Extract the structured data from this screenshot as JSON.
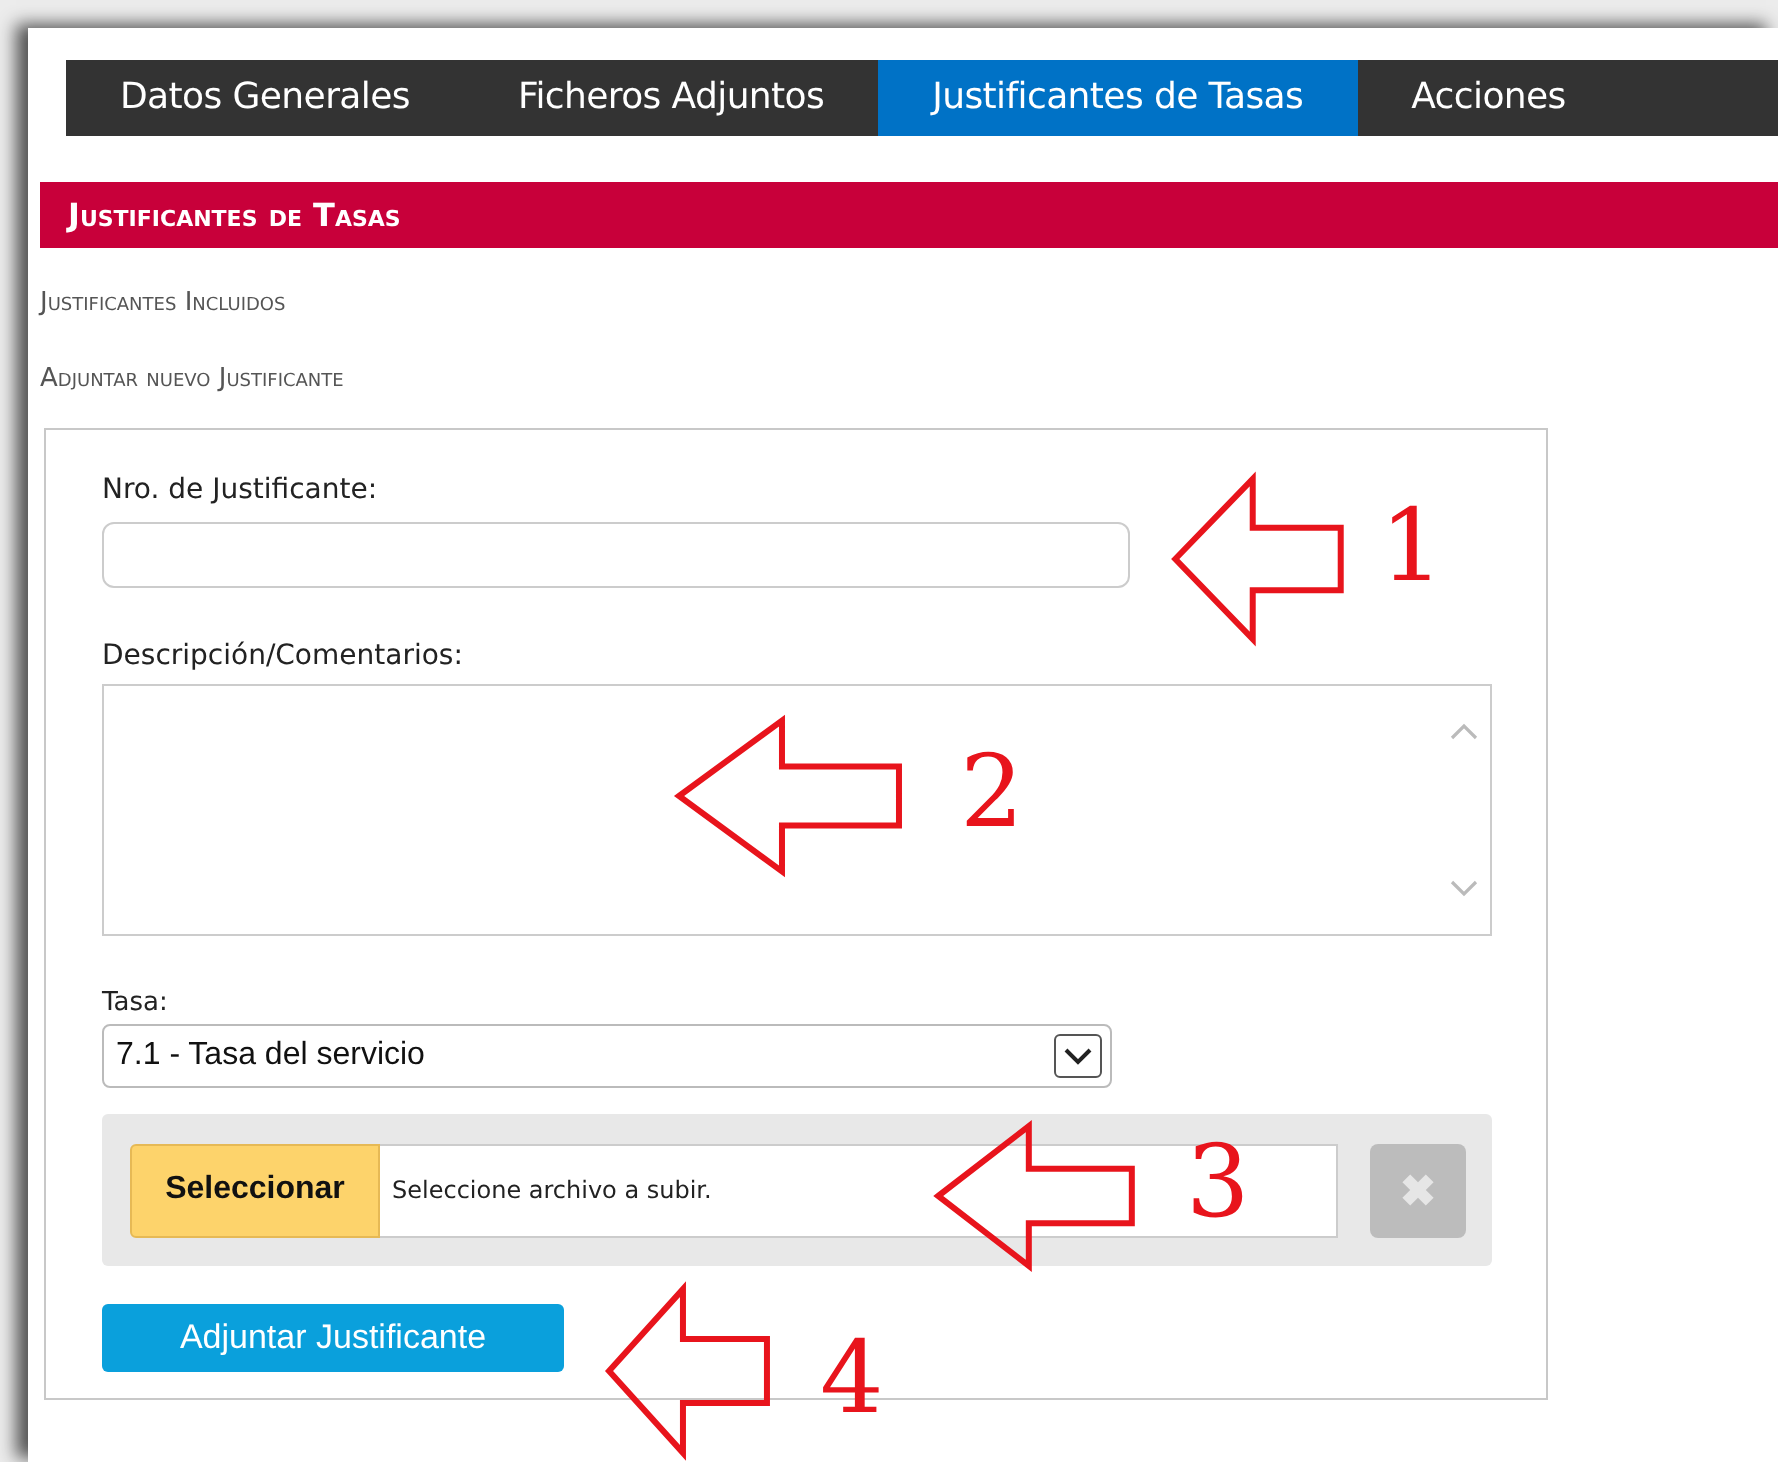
{
  "tabs": [
    {
      "label": "Datos Generales",
      "selected": false
    },
    {
      "label": "Ficheros Adjuntos",
      "selected": false
    },
    {
      "label": "Justificantes de Tasas",
      "selected": true
    },
    {
      "label": "Acciones",
      "selected": false
    }
  ],
  "section_title": "Justificantes de Tasas",
  "links": [
    "Justificantes Incluidos",
    "Adjuntar nuevo Justificante"
  ],
  "form": {
    "number_label": "Nro. de Justificante:",
    "description_label": "Descripción/Comentarios:",
    "tasa_label": "Tasa:",
    "tasa_value": "7.1 - Tasa del servicio",
    "select_button": "Seleccionar",
    "file_placeholder": "Seleccione archivo a subir.",
    "submit_button": "Adjuntar Justificante"
  },
  "annotations": [
    {
      "number": "1"
    },
    {
      "number": "2"
    },
    {
      "number": "3"
    },
    {
      "number": "4"
    }
  ]
}
